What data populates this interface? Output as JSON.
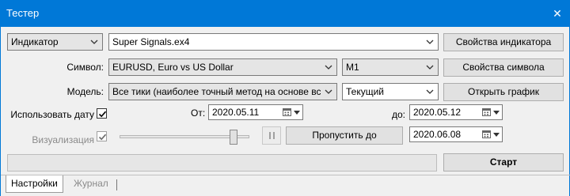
{
  "window": {
    "title": "Тестер",
    "close_glyph": "✕"
  },
  "settings": {
    "type_select": "Индикатор",
    "indicator_file": "Super Signals.ex4",
    "indicator_props_button": "Свойства индикатора",
    "symbol_label": "Символ:",
    "symbol_select": "EURUSD, Euro vs US Dollar",
    "period_select": "M1",
    "symbol_props_button": "Свойства символа",
    "model_label": "Модель:",
    "model_select": "Все тики (наиболее точный метод на основе всех наименьших",
    "spread_select": "Текущий",
    "open_chart_button": "Открыть график",
    "use_date_label": "Использовать дату",
    "use_date_checked": true,
    "from_label": "От:",
    "from_date": "2020.05.11",
    "to_label": "до:",
    "to_date": "2020.05.12",
    "visual_label": "Визуализация",
    "visual_checked": true,
    "speed_level": 0.9,
    "skip_to_button": "Пропустить до",
    "skip_to_date": "2020.06.08",
    "start_button": "Старт",
    "progress": 0
  },
  "tabs": [
    {
      "label": "Настройки",
      "active": true
    },
    {
      "label": "Журнал",
      "active": false
    }
  ],
  "icons": {
    "dropdown": "chevron-down-icon",
    "calendar": "calendar-icon",
    "check": "checkmark-icon",
    "pause": "pause-icon"
  },
  "colors": {
    "titlebar": "#0078d7",
    "progress_fill": "#06b025"
  }
}
